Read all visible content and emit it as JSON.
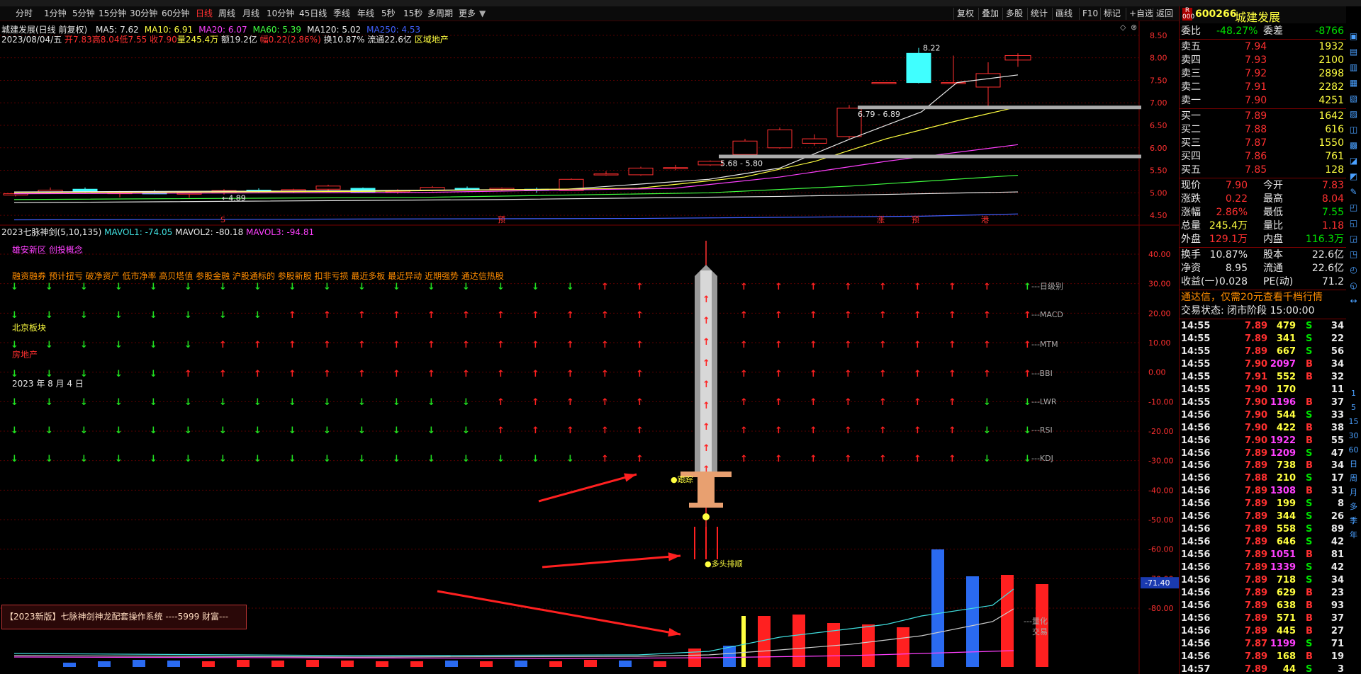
{
  "toolbar": {
    "periods": [
      "分时",
      "1分钟",
      "5分钟",
      "15分钟",
      "30分钟",
      "60分钟",
      "日线",
      "周线",
      "月线",
      "10分钟",
      "45日线",
      "季线",
      "年线",
      "5秒",
      "15秒",
      "多周期",
      "更多"
    ],
    "active_period": "日线",
    "right_buttons": [
      "复权",
      "叠加",
      "多股",
      "统计",
      "画线",
      "F10",
      "标记",
      "+自选",
      "返回"
    ]
  },
  "main_chart": {
    "title": "城建发展(日线 前复权)",
    "ma_items": [
      {
        "label": "MA5: 7.62",
        "color": "#e8e8e8"
      },
      {
        "label": "MA10: 6.91",
        "color": "#ffff40"
      },
      {
        "label": "MA20: 6.07",
        "color": "#ff40ff"
      },
      {
        "label": "MA60: 5.39",
        "color": "#40ff40"
      },
      {
        "label": "MA120: 5.02",
        "color": "#e8e8e8"
      },
      {
        "label": "MA250: 4.53",
        "color": "#4060ff"
      }
    ],
    "ohlc_line": {
      "date": "2023/08/04/五",
      "open": "开7.83",
      "high": "高8.04",
      "low": "低7.55",
      "close": "收7.90",
      "volume": "量245.4万",
      "amount": "额19.2亿",
      "change": "幅0.22(2.86%)",
      "turnover": "换10.87%",
      "float": "流通22.6亿",
      "sector": "区域地产"
    },
    "y_ticks": [
      "8.50",
      "8.00",
      "7.50",
      "7.00",
      "6.50",
      "6.00",
      "5.50",
      "5.00",
      "4.50"
    ],
    "annotations": {
      "high": "8.22",
      "zone_high": "6.79 - 6.89",
      "zone_low": "5.68 - 5.80",
      "low": "4.89"
    },
    "markers": [
      "S",
      "预",
      "涨",
      "预",
      "港"
    ]
  },
  "indicator": {
    "title": "2023七脉神剑(5,10,135)",
    "mavol1": "MAVOL1: -74.05",
    "mavol2": "MAVOL2: -80.18",
    "mavol3": "MAVOL3: -94.81",
    "concepts_a": "雄安新区 创投概念",
    "concepts_b": "融资融券 预计扭亏 破净资产 低市净率 高贝塔值 参股金融 沪股通标的 参股新股 扣非亏损 最近多板 最近异动 近期强势 通达信热股",
    "block": "北京板块",
    "industry": "房地产",
    "date_text": "2023 年 8 月 4 日",
    "row_labels": [
      "---日级别",
      "---MACD",
      "---MTM",
      "---BBI",
      "---LWR",
      "---RSI",
      "---KDJ"
    ],
    "y_ticks": [
      "40.00",
      "30.00",
      "20.00",
      "10.00",
      "0.00",
      "-10.00",
      "-20.00",
      "-30.00",
      "-40.00",
      "-50.00",
      "-60.00",
      "-70.00",
      "-80.00"
    ],
    "current_value": "-71.40",
    "sword_label_top": "●跟踪",
    "sword_label_bottom": "●多头排顺",
    "vol_label": "---量化\n交易",
    "banner": "【2023新版】七脉神剑神龙配套操作系统 ----5999 财富---"
  },
  "quote": {
    "code": "600266",
    "name": "城建发展",
    "weibi_label": "委比",
    "weibi": "-48.27%",
    "weicha_label": "委差",
    "weicha": "-8766",
    "sells": [
      {
        "label": "卖五",
        "price": "7.94",
        "vol": "1932"
      },
      {
        "label": "卖四",
        "price": "7.93",
        "vol": "2100"
      },
      {
        "label": "卖三",
        "price": "7.92",
        "vol": "2898"
      },
      {
        "label": "卖二",
        "price": "7.91",
        "vol": "2282"
      },
      {
        "label": "卖一",
        "price": "7.90",
        "vol": "4251"
      }
    ],
    "buys": [
      {
        "label": "买一",
        "price": "7.89",
        "vol": "1642"
      },
      {
        "label": "买二",
        "price": "7.88",
        "vol": "616"
      },
      {
        "label": "买三",
        "price": "7.87",
        "vol": "1550"
      },
      {
        "label": "买四",
        "price": "7.86",
        "vol": "761"
      },
      {
        "label": "买五",
        "price": "7.85",
        "vol": "128"
      }
    ],
    "stats": [
      {
        "l1": "现价",
        "v1": "7.90",
        "c1": "red",
        "l2": "今开",
        "v2": "7.83",
        "c2": "red"
      },
      {
        "l1": "涨跌",
        "v1": "0.22",
        "c1": "red",
        "l2": "最高",
        "v2": "8.04",
        "c2": "red"
      },
      {
        "l1": "涨幅",
        "v1": "2.86%",
        "c1": "red",
        "l2": "最低",
        "v2": "7.55",
        "c2": "green"
      },
      {
        "l1": "总量",
        "v1": "245.4万",
        "c1": "yellow",
        "l2": "量比",
        "v2": "1.18",
        "c2": "red"
      },
      {
        "l1": "外盘",
        "v1": "129.1万",
        "c1": "red",
        "l2": "内盘",
        "v2": "116.3万",
        "c2": "green"
      }
    ],
    "stats2": [
      {
        "l1": "换手",
        "v1": "10.87%",
        "l2": "股本",
        "v2": "22.6亿"
      },
      {
        "l1": "净资",
        "v1": "8.95",
        "l2": "流通",
        "v2": "22.6亿"
      },
      {
        "l1": "收益(一)",
        "v1": "0.028",
        "l2": "PE(动)",
        "v2": "71.2"
      }
    ],
    "notice": "通达信，仅需20元查看千档行情",
    "trade_status": "交易状态: 闭市阶段 15:00:00",
    "ticks": [
      [
        "14:55",
        "7.89",
        "479",
        "S",
        "34"
      ],
      [
        "14:55",
        "7.89",
        "341",
        "S",
        "22"
      ],
      [
        "14:55",
        "7.89",
        "667",
        "S",
        "56"
      ],
      [
        "14:55",
        "7.90",
        "2097",
        "B",
        "34"
      ],
      [
        "14:55",
        "7.91",
        "552",
        "B",
        "32"
      ],
      [
        "14:55",
        "7.90",
        "170",
        "",
        "11"
      ],
      [
        "14:55",
        "7.90",
        "1196",
        "B",
        "37"
      ],
      [
        "14:56",
        "7.90",
        "544",
        "S",
        "33"
      ],
      [
        "14:56",
        "7.90",
        "422",
        "B",
        "38"
      ],
      [
        "14:56",
        "7.90",
        "1922",
        "B",
        "55"
      ],
      [
        "14:56",
        "7.89",
        "1209",
        "S",
        "47"
      ],
      [
        "14:56",
        "7.89",
        "738",
        "B",
        "34"
      ],
      [
        "14:56",
        "7.88",
        "210",
        "S",
        "17"
      ],
      [
        "14:56",
        "7.89",
        "1308",
        "B",
        "31"
      ],
      [
        "14:56",
        "7.89",
        "199",
        "S",
        "8"
      ],
      [
        "14:56",
        "7.89",
        "344",
        "S",
        "26"
      ],
      [
        "14:56",
        "7.89",
        "558",
        "S",
        "89"
      ],
      [
        "14:56",
        "7.89",
        "646",
        "S",
        "42"
      ],
      [
        "14:56",
        "7.89",
        "1051",
        "B",
        "81"
      ],
      [
        "14:56",
        "7.89",
        "1339",
        "S",
        "42"
      ],
      [
        "14:56",
        "7.89",
        "718",
        "S",
        "34"
      ],
      [
        "14:56",
        "7.89",
        "629",
        "B",
        "23"
      ],
      [
        "14:56",
        "7.89",
        "638",
        "B",
        "93"
      ],
      [
        "14:56",
        "7.89",
        "571",
        "B",
        "37"
      ],
      [
        "14:56",
        "7.89",
        "445",
        "B",
        "27"
      ],
      [
        "14:56",
        "7.87",
        "1199",
        "S",
        "71"
      ],
      [
        "14:56",
        "7.89",
        "168",
        "B",
        "19"
      ],
      [
        "14:57",
        "7.89",
        "44",
        "S",
        "3"
      ]
    ]
  },
  "sidebar_icons": [
    "1",
    "5",
    "15",
    "30",
    "60",
    "日",
    "周",
    "月",
    "多",
    "季",
    "年"
  ],
  "colors": {
    "up": "#ff3030",
    "down": "#00e000",
    "accent": "#ffff40"
  }
}
